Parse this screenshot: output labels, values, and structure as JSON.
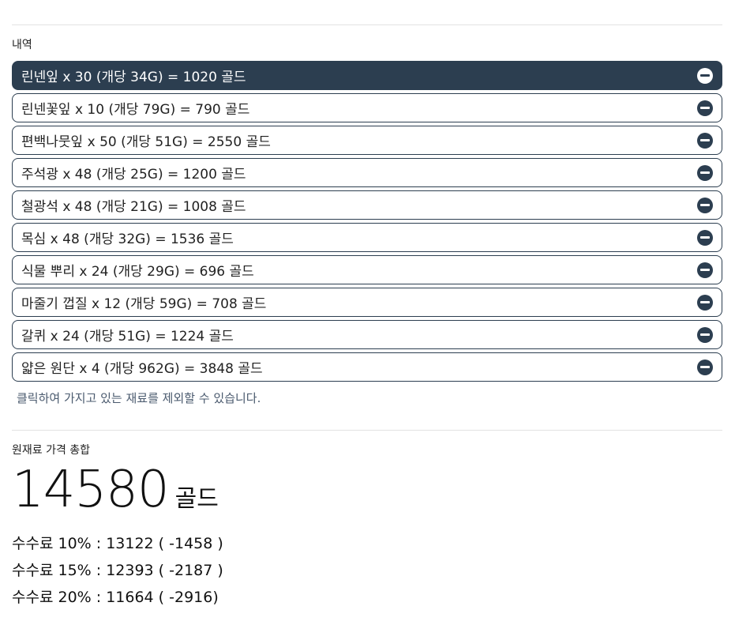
{
  "history": {
    "label": "내역",
    "items": [
      {
        "text": "린넨잎 x 30 (개당 34G) = 1020 골드",
        "active": true
      },
      {
        "text": "린넨꽃잎 x 10 (개당 79G) = 790 골드",
        "active": false
      },
      {
        "text": "편백나뭇잎 x 50 (개당 51G) = 2550 골드",
        "active": false
      },
      {
        "text": "주석광 x 48 (개당 25G) = 1200 골드",
        "active": false
      },
      {
        "text": "철광석 x 48 (개당 21G) = 1008 골드",
        "active": false
      },
      {
        "text": "목심 x 48 (개당 32G) = 1536 골드",
        "active": false
      },
      {
        "text": "식물 뿌리 x 24 (개당 29G) = 696 골드",
        "active": false
      },
      {
        "text": "마줄기 껍질 x 12 (개당 59G) = 708 골드",
        "active": false
      },
      {
        "text": "갈퀴 x 24 (개당 51G) = 1224 골드",
        "active": false
      },
      {
        "text": "얇은 원단 x 4 (개당 962G) = 3848 골드",
        "active": false
      }
    ],
    "hint": "클릭하여 가지고 있는 재료를 제외할 수 있습니다."
  },
  "summary": {
    "label": "원재료 가격 총합",
    "total": "14580",
    "unit": "골드",
    "fees": [
      "수수료 10% : 13122 ( -1458 )",
      "수수료 15% : 12393 ( -2187 )",
      "수수료 20% : 11664 ( -2916)"
    ]
  },
  "icons": {
    "remove": "minus-circle-icon"
  },
  "colors": {
    "accent": "#2c3e50",
    "hint": "#4a5a6e"
  }
}
